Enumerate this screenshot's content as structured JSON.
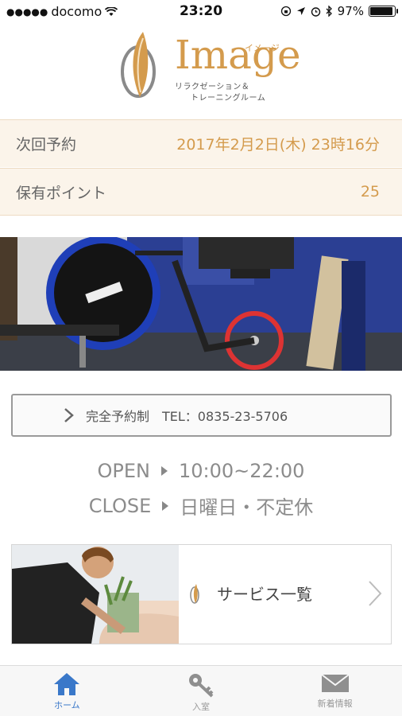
{
  "status_bar": {
    "carrier": "docomo",
    "time": "23:20",
    "battery": "97%",
    "battery_level": 0.97
  },
  "logo": {
    "word": "Image",
    "kana": "イメージ",
    "sub_line1": "リラクゼーション＆",
    "sub_line2": "トレーニングルーム"
  },
  "next_reservation": {
    "label": "次回予約",
    "value": "2017年2月2日(木) 23時16分"
  },
  "points": {
    "label": "保有ポイント",
    "value": "25"
  },
  "tel_button": {
    "label": "完全予約制　TEL：0835-23-5706"
  },
  "hours": {
    "open_label": "OPEN",
    "open_value": "10:00~22:00",
    "close_label": "CLOSE",
    "close_value": "日曜日・不定休"
  },
  "service_card": {
    "label": "サービス一覧"
  },
  "tabs": [
    {
      "label": "ホーム",
      "icon": "home-icon",
      "active": true
    },
    {
      "label": "入室",
      "icon": "key-icon",
      "active": false
    },
    {
      "label": "新着情報",
      "icon": "mail-icon",
      "active": false
    }
  ],
  "colors": {
    "accent_gold": "#d49b4d",
    "tab_active": "#3a78c9",
    "row_bg": "#fbf4ea"
  }
}
